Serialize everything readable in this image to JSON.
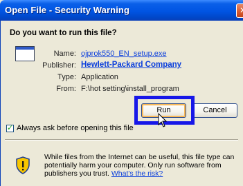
{
  "window": {
    "title": "Open File - Security Warning"
  },
  "dialog": {
    "question": "Do you want to run this file?",
    "fields": {
      "name_label": "Name:",
      "name_value": "ojprok550_EN_setup.exe",
      "publisher_label": "Publisher:",
      "publisher_value": "Hewlett-Packard Company",
      "type_label": "Type:",
      "type_value": "Application",
      "from_label": "From:",
      "from_value": "F:\\hot setting\\install_program"
    },
    "buttons": {
      "run": "Run",
      "cancel": "Cancel"
    },
    "checkbox": {
      "label": "Always ask before opening this file",
      "checked": true
    },
    "warning": {
      "text": "While files from the Internet can be useful, this file type can potentially harm your computer. Only run software from publishers you trust.",
      "link": "What's the risk?"
    }
  },
  "colors": {
    "titlebar": "#0054e3",
    "highlight": "#1717e8",
    "link": "#0b3fdc",
    "dialog_bg": "#ece9d8"
  },
  "icons": [
    "close-icon",
    "application-icon",
    "cursor-icon",
    "shield-warning-icon"
  ]
}
